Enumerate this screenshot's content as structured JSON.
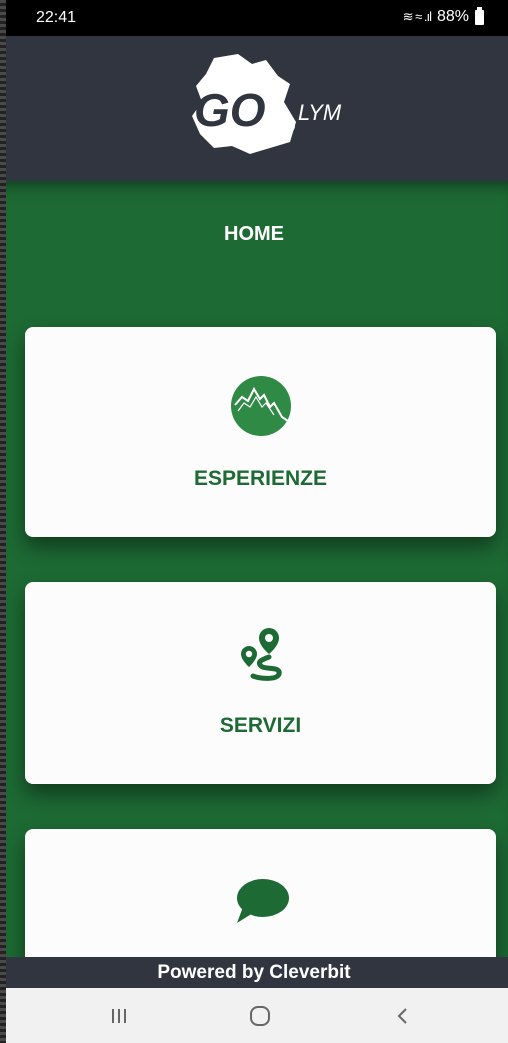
{
  "status_bar": {
    "time": "22:41",
    "signal_icons": "≋ ≈ .ıl",
    "battery_percent": "88%"
  },
  "header": {
    "logo_text": "GO",
    "logo_suffix": "LYM"
  },
  "page": {
    "title": "HOME"
  },
  "cards": [
    {
      "label": "ESPERIENZE",
      "icon": "mountain-icon"
    },
    {
      "label": "SERVIZI",
      "icon": "route-icon"
    },
    {
      "label": "",
      "icon": "chat-icon"
    }
  ],
  "footer": {
    "text": "Powered by Cleverbit"
  },
  "nav": {
    "recents": "recents-icon",
    "home": "home-icon",
    "back": "back-icon"
  },
  "colors": {
    "primary_green": "#1d6a34",
    "header_dark": "#303540",
    "card_bg": "#fcfcfc"
  }
}
